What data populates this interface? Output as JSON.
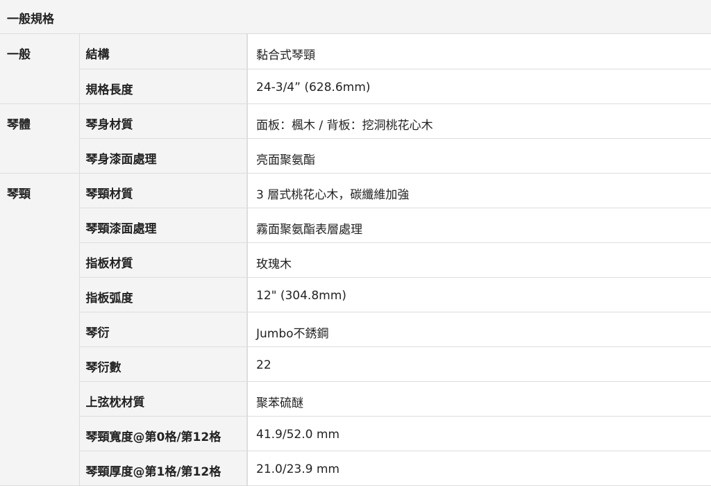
{
  "section": {
    "title": "一般規格"
  },
  "groups": [
    {
      "name": "一般",
      "rows": [
        {
          "label": "結構",
          "value": "黏合式琴頸"
        },
        {
          "label": "規格長度",
          "value": "24-3/4” (628.6mm)"
        }
      ]
    },
    {
      "name": "琴體",
      "rows": [
        {
          "label": "琴身材質",
          "value": "面板：楓木 / 背板：挖洞桃花心木"
        },
        {
          "label": "琴身漆面處理",
          "value": "亮面聚氨酯"
        }
      ]
    },
    {
      "name": "琴頸",
      "rows": [
        {
          "label": "琴頸材質",
          "value": "3 層式桃花心木，碳纖維加強"
        },
        {
          "label": "琴頸漆面處理",
          "value": "霧面聚氨酯表層處理"
        },
        {
          "label": "指板材質",
          "value": "玫瑰木"
        },
        {
          "label": "指板弧度",
          "value": "12\" (304.8mm)"
        },
        {
          "label": "琴衍",
          "value": "Jumbo不銹鋼"
        },
        {
          "label": "琴衍數",
          "value": "22"
        },
        {
          "label": "上弦枕材質",
          "value": "聚苯硫醚"
        },
        {
          "label": "琴頸寬度@第0格/第12格",
          "value": "41.9/52.0 mm"
        },
        {
          "label": "琴頸厚度@第1格/第12格",
          "value": "21.0/23.9 mm"
        }
      ]
    }
  ]
}
